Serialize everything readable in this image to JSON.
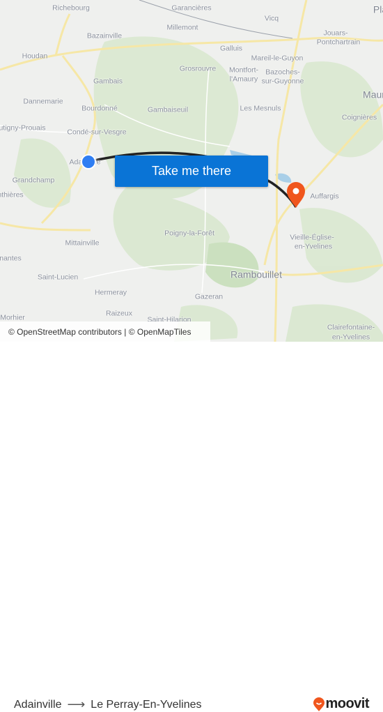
{
  "map": {
    "labels": [
      "Richebourg",
      "Garancières",
      "Vicq",
      "Pla",
      "Millemont",
      "Bazainville",
      "Jouars-",
      "Pontchartrain",
      "Houdan",
      "Galluis",
      "Mareil-le-Guyon",
      "Grosrouvre",
      "Montfort-",
      "l'Amaury",
      "Bazoches-",
      "sur-Guyonne",
      "Gambais",
      "Maur",
      "Dannemarie",
      "Bourdonné",
      "Gambaiseuil",
      "Les Mesnuls",
      "Coignières",
      "utigny-Prouais",
      "Condé-sur-Vesgre",
      "Adainville",
      "Grandchamp",
      "nthières",
      "Auffargis",
      "Poigny-la-Forêt",
      "Mittainville",
      "Vieille-Église-",
      "en-Yvelines",
      "nantes",
      "Rambouillet",
      "Saint-Lucien",
      "Hermeray",
      "Gazeran",
      "Raizeux",
      "Saint-Hilarion",
      "Morhier",
      "Clairefontaine-",
      "en-Yvelines"
    ],
    "route_color": "#222222",
    "origin_color": "#2f7ef2",
    "destination_color": "#f0561d",
    "attribution": "© OpenStreetMap contributors | © OpenMapTiles"
  },
  "cta": {
    "label": "Take me there",
    "color": "#0a74d6"
  },
  "footer": {
    "origin": "Adainville",
    "arrow": "⟶",
    "destination": "Le Perray-En-Yvelines",
    "brand": "moovit",
    "brand_color": "#f0561d"
  }
}
